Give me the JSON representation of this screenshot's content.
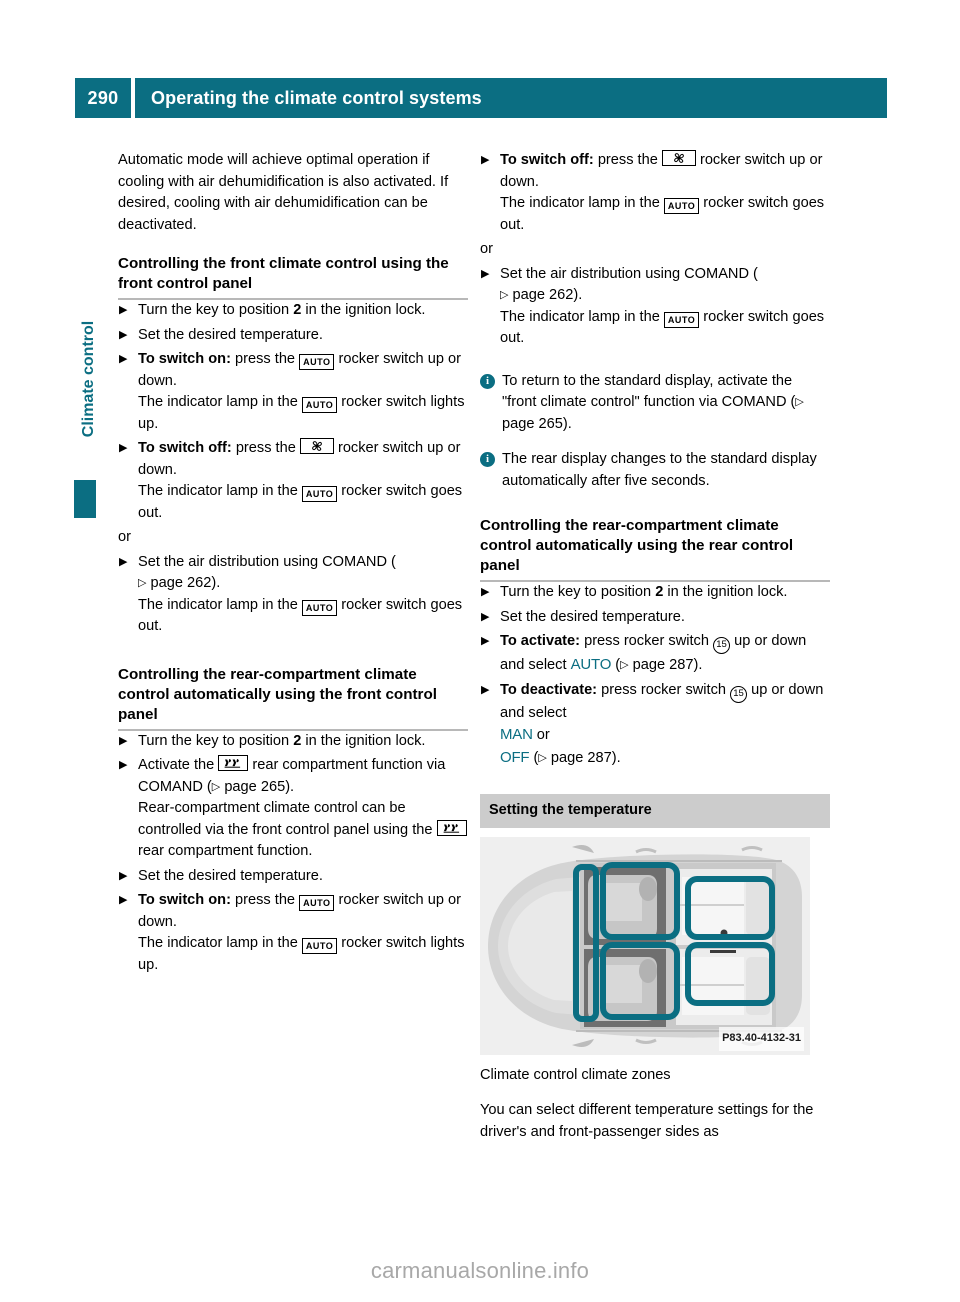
{
  "header": {
    "page_number": "290",
    "title": "Operating the climate control systems"
  },
  "side_tab": {
    "label": "Climate control",
    "accent_color": "#0b6e82"
  },
  "left_column": {
    "intro_paragraph": "Automatic mode will achieve optimal operation if cooling with air dehumidification is also activated. If desired, cooling with air dehumidification can be deactivated.",
    "section1_heading": "Controlling the front climate control using the front control panel",
    "s1_step1_a": "Turn the key to position ",
    "s1_step1_b": "2",
    "s1_step1_c": " in the ignition lock.",
    "s1_step2": "Set the desired temperature.",
    "s1_step3_lead": "To switch on:",
    "s1_step3_a": " press the ",
    "s1_step3_b": " rocker switch up or down.",
    "s1_step3_c": "The indicator lamp in the ",
    "s1_step3_d": " rocker switch lights up.",
    "s1_step4_lead": "To switch off:",
    "s1_step4_a": " press the ",
    "s1_step4_b": " rocker switch up or down.",
    "s1_step4_c": "The indicator lamp in the ",
    "s1_step4_d": " rocker switch goes out.",
    "s1_or": "or",
    "s1_step5_a": "Set the air distribution using COMAND (",
    "s1_step5_page": "page 262",
    "s1_step5_b": ").",
    "s1_step5_c": "The indicator lamp in the ",
    "s1_step5_d": " rocker switch goes out.",
    "section2_heading": "Controlling the rear-compartment climate control automatically using the front control panel",
    "s2_step1_a": "Turn the key to position ",
    "s2_step1_b": "2",
    "s2_step1_c": " in the ignition lock.",
    "s2_step2_a": "Activate the ",
    "s2_step2_b": " rear compartment function via COMAND (",
    "s2_step2_page": "page 265",
    "s2_step2_c": ").",
    "s2_step2_d": "Rear-compartment climate control can be controlled via the front control panel using the ",
    "s2_step2_e": " rear compartment function.",
    "s2_step3": "Set the desired temperature.",
    "s2_step4_lead": "To switch on:",
    "s2_step4_a": " press the ",
    "s2_step4_b": " rocker switch up or down.",
    "s2_step4_c": "The indicator lamp in the ",
    "s2_step4_d": " rocker switch lights up."
  },
  "right_column": {
    "r_step1_lead": "To switch off:",
    "r_step1_a": " press the ",
    "r_step1_b": " rocker switch up or down.",
    "r_step1_c": "The indicator lamp in the ",
    "r_step1_d": " rocker switch goes out.",
    "r_or": "or",
    "r_step2_a": "Set the air distribution using COMAND (",
    "r_step2_page": "page 262",
    "r_step2_b": ").",
    "r_step2_c": "The indicator lamp in the ",
    "r_step2_d": " rocker switch goes out.",
    "note1_a": "To return to the standard display, activate the \"front climate control\" function via COMAND (",
    "note1_page": "page 265",
    "note1_b": ").",
    "note2": "The rear display changes to the standard display automatically after five seconds.",
    "section3_heading": "Controlling the rear-compartment climate control automatically using the rear control panel",
    "s3_step1_a": "Turn the key to position ",
    "s3_step1_b": "2",
    "s3_step1_c": " in the ignition lock.",
    "s3_step2": "Set the desired temperature.",
    "s3_step3_lead": "To activate:",
    "s3_step3_a": " press rocker switch ",
    "s3_step3_num": "15",
    "s3_step3_b": " up or down and select ",
    "s3_step3_disp": "AUTO",
    "s3_step3_c": " (",
    "s3_step3_page": "page 287",
    "s3_step3_d": ").",
    "s3_step4_lead": "To deactivate:",
    "s3_step4_a": " press rocker switch ",
    "s3_step4_num": "15",
    "s3_step4_b": " up or down and select ",
    "s3_step4_disp1": "MAN",
    "s3_step4_c": " or",
    "s3_step4_disp2": "OFF",
    "s3_step4_d": " (",
    "s3_step4_page": "page 287",
    "s3_step4_e": ").",
    "figure_title": "Setting the temperature",
    "figure_code": "P83.40-4132-31",
    "figure_caption": "Climate control climate zones",
    "closing_paragraph": "You can select different temperature settings for the driver's and front-passenger sides as"
  },
  "symbols": {
    "auto_label": "AUTO",
    "fan_name": "fan-symbol",
    "rear_name": "rear-compartment-symbol",
    "ref_arrow": "▷"
  },
  "watermark": "carmanualsonline.info"
}
